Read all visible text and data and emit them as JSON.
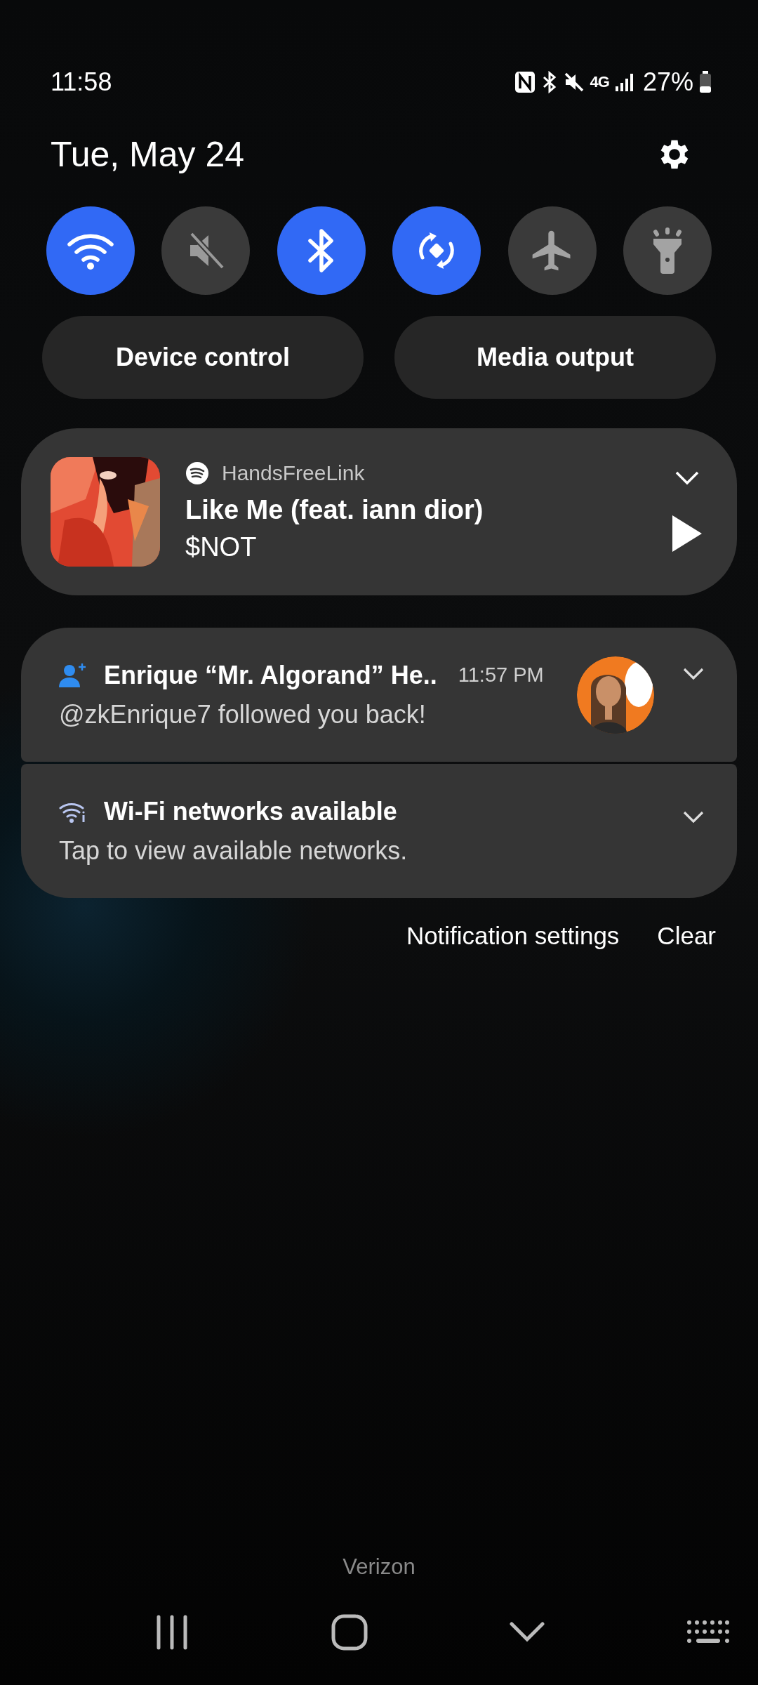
{
  "status_bar": {
    "time": "11:58",
    "network": "4G",
    "battery": "27%"
  },
  "date": "Tue, May 24",
  "quick_toggles": [
    {
      "kind": "wifi",
      "on": true
    },
    {
      "kind": "sound",
      "on": false
    },
    {
      "kind": "bluetooth",
      "on": true
    },
    {
      "kind": "rotate",
      "on": true
    },
    {
      "kind": "airplane",
      "on": false
    },
    {
      "kind": "flashlight",
      "on": false
    }
  ],
  "shortcut_buttons": [
    "Device control",
    "Media output"
  ],
  "media_player": {
    "app": "HandsFreeLink",
    "title": "Like Me (feat. iann dior)",
    "artist": "$NOT"
  },
  "notifications": [
    {
      "kind": "follow",
      "title": "Enrique “Mr. Algorand” He..",
      "time": "11:57 PM",
      "text": "@zkEnrique7 followed you back!"
    },
    {
      "kind": "wifi",
      "title": "Wi-Fi networks available",
      "text": "Tap to view available networks."
    }
  ],
  "footer_actions": [
    "Notification settings",
    "Clear"
  ],
  "carrier": "Verizon"
}
